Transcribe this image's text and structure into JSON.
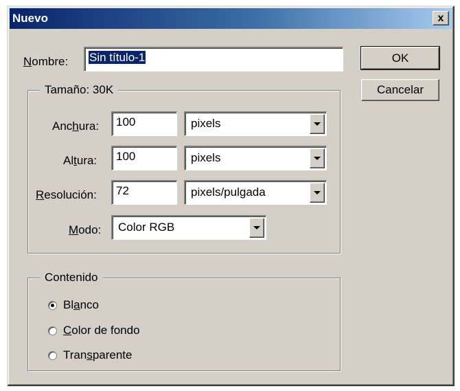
{
  "window": {
    "title": "Nuevo",
    "close_glyph": "x"
  },
  "name_field": {
    "label_mnemonic": "N",
    "label_rest": "ombre:",
    "value": "Sin título-1"
  },
  "buttons": {
    "ok": "OK",
    "cancel": "Cancelar"
  },
  "size_group": {
    "legend": "Tamaño:  30K",
    "width": {
      "label_pre": "Anc",
      "label_mnemonic": "h",
      "label_post": "ura:",
      "value": "100",
      "unit": "pixels"
    },
    "height": {
      "label_pre": "Al",
      "label_mnemonic": "t",
      "label_post": "ura:",
      "value": "100",
      "unit": "pixels"
    },
    "resolution": {
      "label_pre": "",
      "label_mnemonic": "R",
      "label_post": "esolución:",
      "value": "72",
      "unit": "pixels/pulgada"
    },
    "mode": {
      "label_pre": "",
      "label_mnemonic": "M",
      "label_post": "odo:",
      "value": "Color RGB"
    }
  },
  "content_group": {
    "legend": "Contenido",
    "options": [
      {
        "pre": "Bl",
        "mnemonic": "a",
        "post": "nco",
        "selected": true
      },
      {
        "pre": "",
        "mnemonic": "C",
        "post": "olor de fondo",
        "selected": false
      },
      {
        "pre": "Tran",
        "mnemonic": "s",
        "post": "parente",
        "selected": false
      }
    ]
  },
  "colors": {
    "dialog_face": "#d4d0c8",
    "title_start": "#0a246a",
    "title_end": "#a6caf0",
    "selection": "#0a246a"
  },
  "icons": {
    "dropdown": "chevron-down-icon",
    "close": "close-icon"
  }
}
